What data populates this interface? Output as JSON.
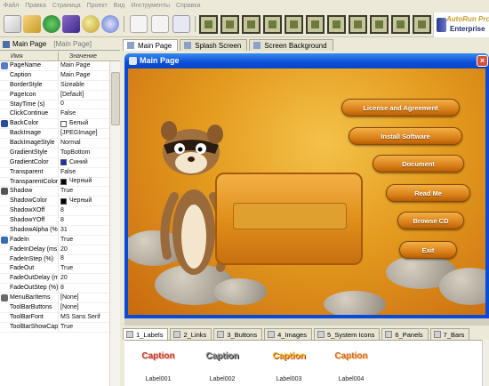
{
  "menu": {
    "items": [
      "Файл",
      "Правка",
      "Страница",
      "Проект",
      "Вид",
      "Инструменты",
      "Справка"
    ]
  },
  "toolbar": {
    "brand_line1": "AutoRun Pro",
    "brand_line2": "Enterprise"
  },
  "left_panel": {
    "title": "Main Page",
    "subtitle": "[Main Page]"
  },
  "property_grid": {
    "col_name": "Имя",
    "col_value": "Значение",
    "rows": [
      {
        "name": "PageName",
        "value": "Main Page"
      },
      {
        "name": "Caption",
        "value": "Main Page"
      },
      {
        "name": "BorderStyle",
        "value": "Sizeable"
      },
      {
        "name": "PageIcon",
        "value": "[Default]"
      },
      {
        "name": "StayTime (s)",
        "value": "0"
      },
      {
        "name": "ClickContinue",
        "value": "False"
      },
      {
        "name": "BackColor",
        "value": "Белый",
        "swatch": "#ffffff"
      },
      {
        "name": "BackImage",
        "value": "[JPEGImage]"
      },
      {
        "name": "BackImageStyle",
        "value": "Normal"
      },
      {
        "name": "GradientStyle",
        "value": "TopBottom"
      },
      {
        "name": "GradientColor",
        "value": "Синий",
        "swatch": "#1a2fb0"
      },
      {
        "name": "Transparent",
        "value": "False"
      },
      {
        "name": "TransparentColor",
        "value": "Черный",
        "swatch": "#000000"
      },
      {
        "name": "Shadow",
        "value": "True"
      },
      {
        "name": "ShadowColor",
        "value": "Черный",
        "swatch": "#000000"
      },
      {
        "name": "ShadowXOff",
        "value": "8"
      },
      {
        "name": "ShadowYOff",
        "value": "8"
      },
      {
        "name": "ShadowAlpha (%)",
        "value": "31"
      },
      {
        "name": "FadeIn",
        "value": "True"
      },
      {
        "name": "FadeInDelay (ms)",
        "value": "20"
      },
      {
        "name": "FadeInStep (%)",
        "value": "8"
      },
      {
        "name": "FadeOut",
        "value": "True"
      },
      {
        "name": "FadeOutDelay (ms)",
        "value": "20"
      },
      {
        "name": "FadeOutStep (%)",
        "value": "8"
      },
      {
        "name": "MenuBarItems",
        "value": "[None]"
      },
      {
        "name": "ToolBarButtons",
        "value": "[None]"
      },
      {
        "name": "ToolBarFont",
        "value": "MS Sans Serif"
      },
      {
        "name": "ToolBarShowCaption",
        "value": "True"
      }
    ]
  },
  "doc_tabs": [
    "Main Page",
    "Splash Screen",
    "Screen Background"
  ],
  "canvas": {
    "window_title": "Main Page",
    "buttons": [
      "License and Agreement",
      "Install Software",
      "Document",
      "Read Me",
      "Browse CD",
      "Exit"
    ]
  },
  "component_tabs": [
    "1_Labels",
    "2_Links",
    "3_Buttons",
    "4_Images",
    "5_System Icons",
    "6_Panels",
    "7_Bars"
  ],
  "components": [
    {
      "caption": "Caption",
      "label": "Label001",
      "color": "#c0392b"
    },
    {
      "caption": "Caption",
      "label": "Label002",
      "color": "#8a8a8a"
    },
    {
      "caption": "Caption",
      "label": "Label003",
      "color": "#e8c020"
    },
    {
      "caption": "Caption",
      "label": "Label004",
      "color": "#d06a20"
    }
  ],
  "colors": {
    "xp_title": "#0b4fd8",
    "stage_orange": "#e39a1e",
    "button_orange": "#d67a14"
  }
}
